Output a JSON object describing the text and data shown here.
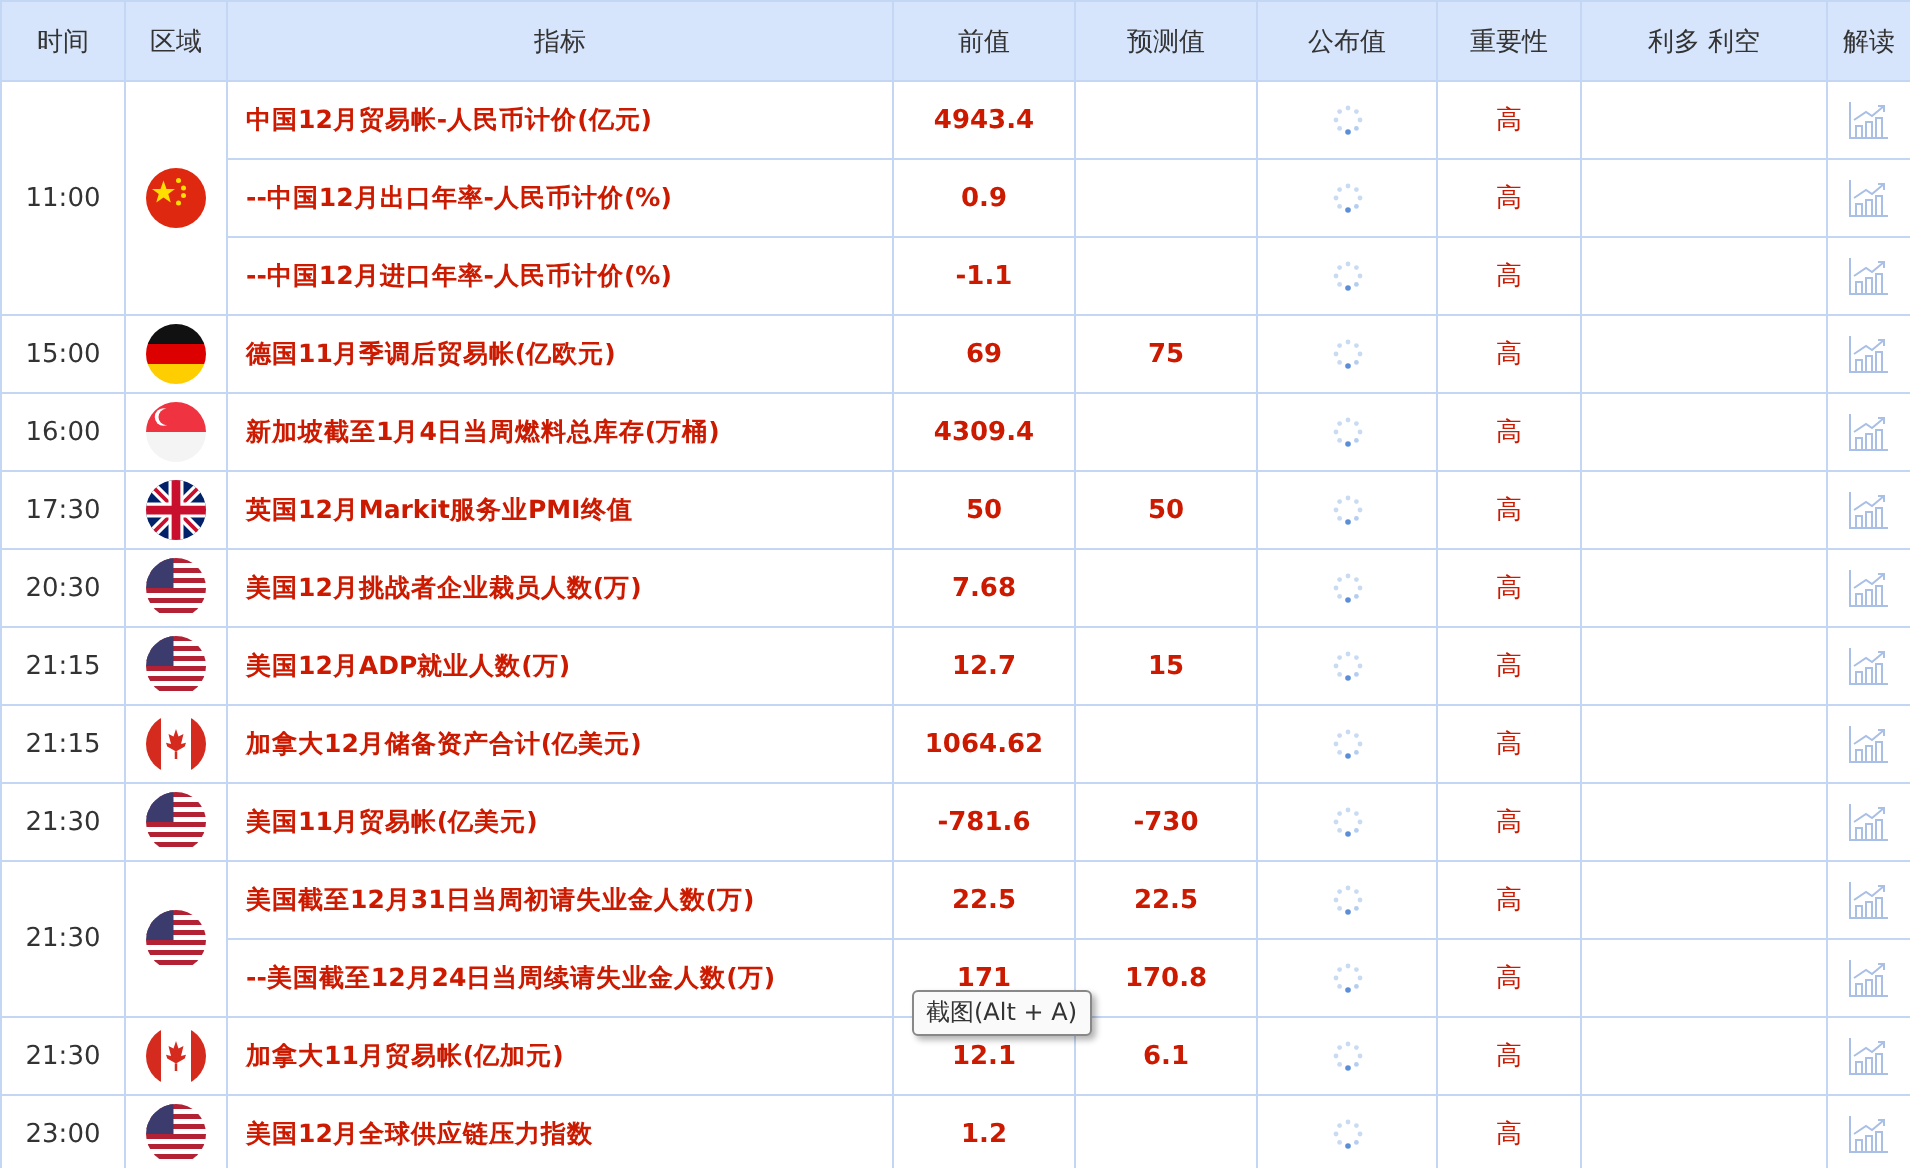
{
  "table": {
    "columns": [
      "时间",
      "区域",
      "指标",
      "前值",
      "预测值",
      "公布值",
      "重要性",
      "利多 利空",
      "解读"
    ],
    "groups": [
      {
        "time": "11:00",
        "kind": "china",
        "rows": [
          {
            "indicator": "中国12月贸易帐-人民币计价(亿元)",
            "previous": "4943.4",
            "forecast": "",
            "importance": "高"
          },
          {
            "indicator": "--中国12月出口年率-人民币计价(%)",
            "previous": "0.9",
            "forecast": "",
            "importance": "高"
          },
          {
            "indicator": "--中国12月进口年率-人民币计价(%)",
            "previous": "-1.1",
            "forecast": "",
            "importance": "高"
          }
        ]
      },
      {
        "time": "15:00",
        "kind": "germany",
        "rows": [
          {
            "indicator": "德国11月季调后贸易帐(亿欧元)",
            "previous": "69",
            "forecast": "75",
            "importance": "高"
          }
        ]
      },
      {
        "time": "16:00",
        "kind": "singapore",
        "rows": [
          {
            "indicator": "新加坡截至1月4日当周燃料总库存(万桶)",
            "previous": "4309.4",
            "forecast": "",
            "importance": "高"
          }
        ]
      },
      {
        "time": "17:30",
        "kind": "uk",
        "rows": [
          {
            "indicator": "英国12月Markit服务业PMI终值",
            "previous": "50",
            "forecast": "50",
            "importance": "高"
          }
        ]
      },
      {
        "time": "20:30",
        "kind": "usa",
        "rows": [
          {
            "indicator": "美国12月挑战者企业裁员人数(万)",
            "previous": "7.68",
            "forecast": "",
            "importance": "高"
          }
        ]
      },
      {
        "time": "21:15",
        "kind": "usa",
        "rows": [
          {
            "indicator": "美国12月ADP就业人数(万)",
            "previous": "12.7",
            "forecast": "15",
            "importance": "高"
          }
        ]
      },
      {
        "time": "21:15",
        "kind": "canada",
        "rows": [
          {
            "indicator": "加拿大12月储备资产合计(亿美元)",
            "previous": "1064.62",
            "forecast": "",
            "importance": "高"
          }
        ]
      },
      {
        "time": "21:30",
        "kind": "usa",
        "rows": [
          {
            "indicator": "美国11月贸易帐(亿美元)",
            "previous": "-781.6",
            "forecast": "-730",
            "importance": "高"
          }
        ]
      },
      {
        "time": "21:30",
        "kind": "usa",
        "rows": [
          {
            "indicator": "美国截至12月31日当周初请失业金人数(万)",
            "previous": "22.5",
            "forecast": "22.5",
            "importance": "高"
          },
          {
            "indicator": "--美国截至12月24日当周续请失业金人数(万)",
            "previous": "171",
            "forecast": "170.8",
            "importance": "高"
          }
        ]
      },
      {
        "time": "21:30",
        "kind": "canada",
        "rows": [
          {
            "indicator": "加拿大11月贸易帐(亿加元)",
            "previous": "12.1",
            "forecast": "6.1",
            "importance": "高"
          }
        ]
      },
      {
        "time": "23:00",
        "kind": "usa",
        "rows": [
          {
            "indicator": "美国12月全球供应链压力指数",
            "previous": "1.2",
            "forecast": "",
            "importance": "高"
          }
        ]
      }
    ]
  },
  "tooltip": "截图(Alt + A)"
}
